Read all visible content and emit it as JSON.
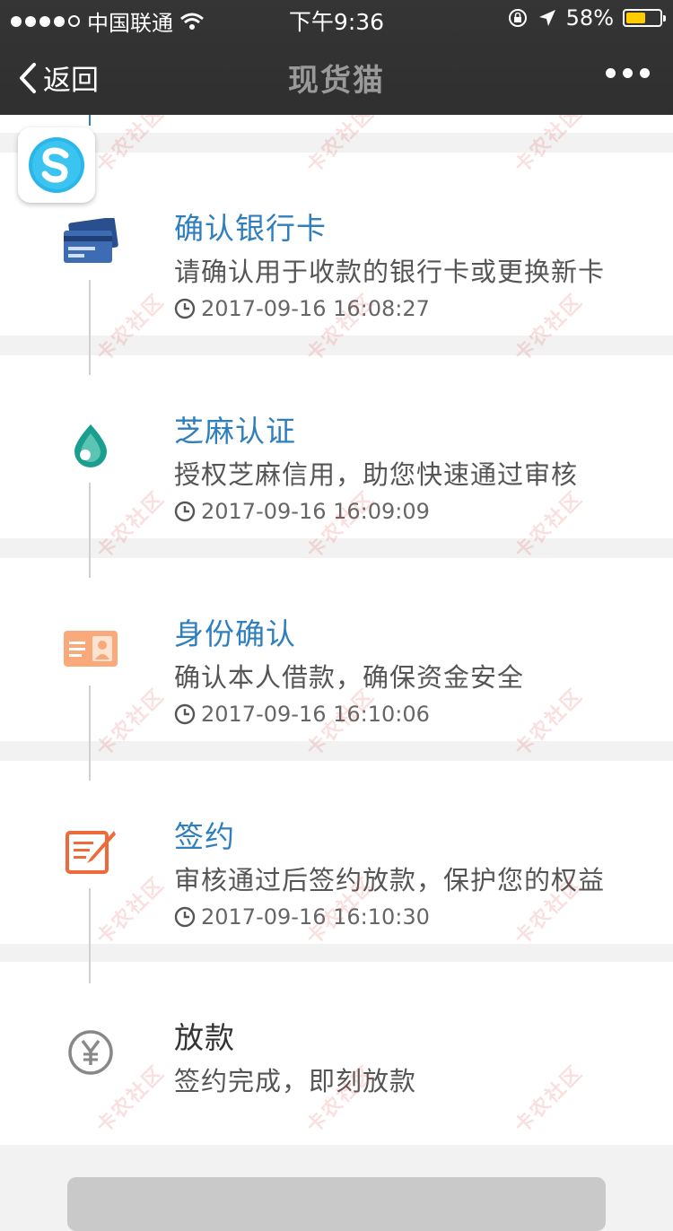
{
  "status_bar": {
    "carrier": "中国联通",
    "time": "下午9:36",
    "battery_percent": "58%",
    "battery_level": 0.58,
    "battery_color": "#ffcc00"
  },
  "navbar": {
    "back_label": "返回",
    "title": "现货猫"
  },
  "steps": [
    {
      "title": "确认银行卡",
      "desc": "请确认用于收款的银行卡或更换新卡",
      "time": "2017-09-16 16:08:27",
      "icon": "bank-card-icon"
    },
    {
      "title": "芝麻认证",
      "desc": "授权芝麻信用，助您快速通过审核",
      "time": "2017-09-16 16:09:09",
      "icon": "sesame-drop-icon"
    },
    {
      "title": "身份确认",
      "desc": "确认本人借款，确保资金安全",
      "time": "2017-09-16 16:10:06",
      "icon": "id-card-icon"
    },
    {
      "title": "签约",
      "desc": "审核通过后签约放款，保护您的权益",
      "time": "2017-09-16 16:10:30",
      "icon": "sign-contract-icon"
    },
    {
      "title": "放款",
      "desc": "签约完成，即刻放款",
      "icon": "yuan-coin-icon"
    }
  ],
  "watermark_text": "卡农社区",
  "colors": {
    "accent": "#2f7fbf",
    "navbar": "#333333"
  }
}
